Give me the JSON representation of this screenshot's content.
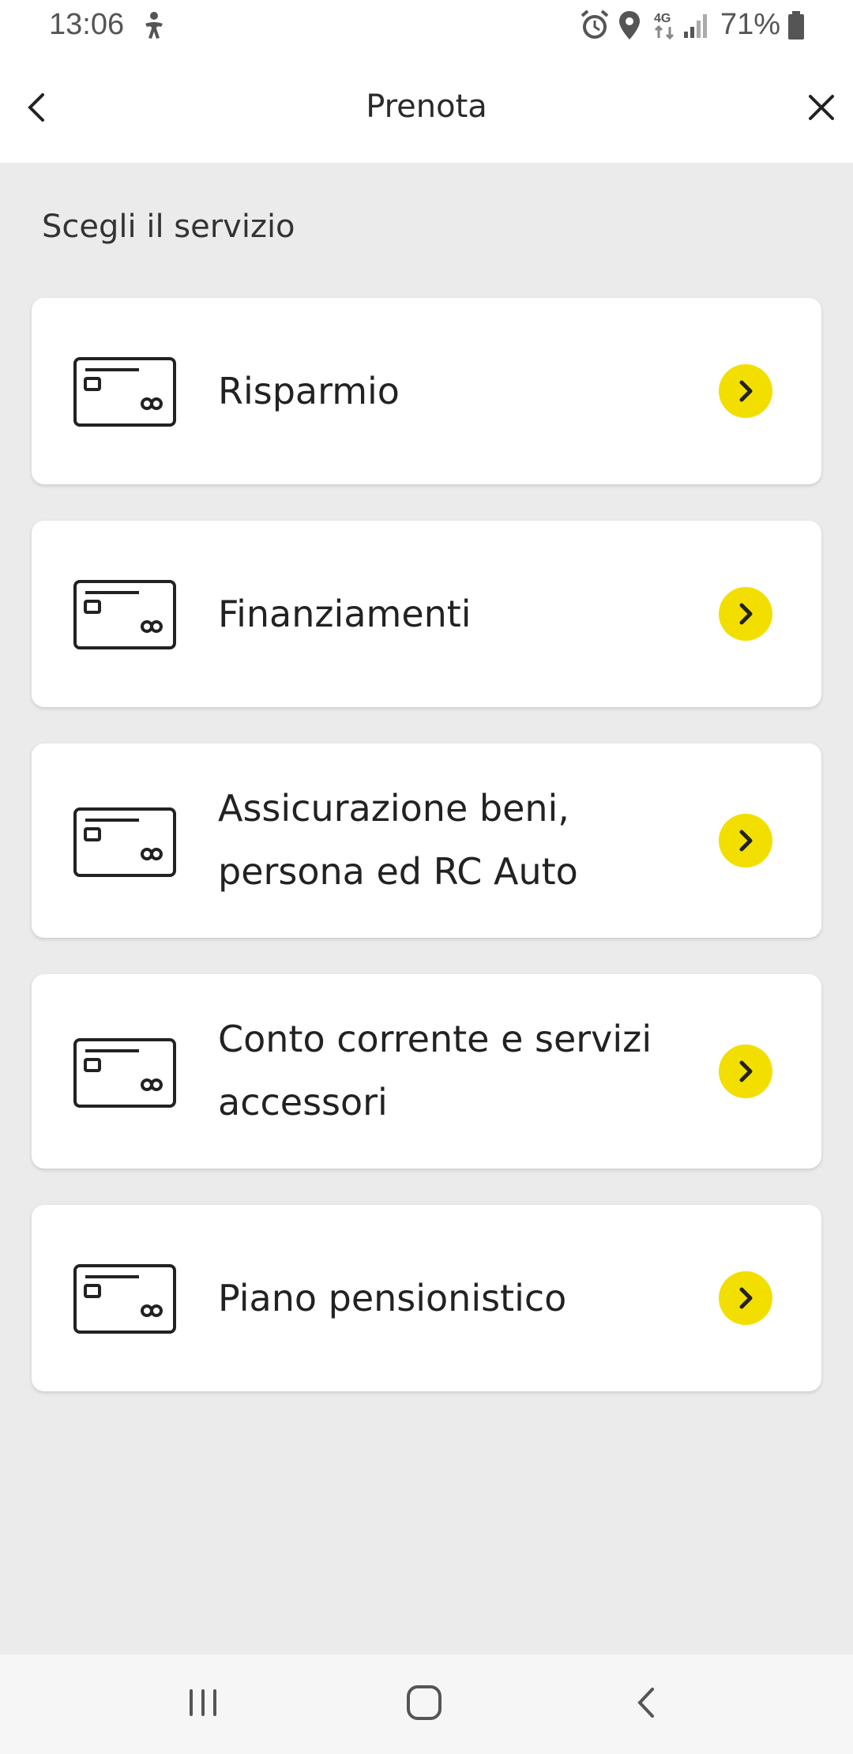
{
  "status_bar": {
    "time": "13:06",
    "battery": "71%",
    "icons": [
      "accessibility-icon",
      "alarm-icon",
      "location-icon",
      "4g-icon",
      "signal-icon",
      "battery-icon"
    ]
  },
  "header": {
    "title": "Prenota",
    "back_icon": "chevron-left-icon",
    "close_icon": "close-icon"
  },
  "section_title": "Scegli il servizio",
  "services": [
    {
      "line1": "Risparmio",
      "line2": ""
    },
    {
      "line1": "Finanziamenti",
      "line2": ""
    },
    {
      "line1": "Assicurazione beni,",
      "line2": "persona ed RC Auto"
    },
    {
      "line1": "Conto corrente e servizi",
      "line2": "accessori"
    },
    {
      "line1": "Piano pensionistico",
      "line2": ""
    }
  ],
  "colors": {
    "accent": "#f2df00",
    "background": "#ebebeb",
    "card": "#ffffff"
  },
  "nav_bar": {
    "icons": [
      "recent-apps-icon",
      "home-icon",
      "back-icon"
    ]
  }
}
